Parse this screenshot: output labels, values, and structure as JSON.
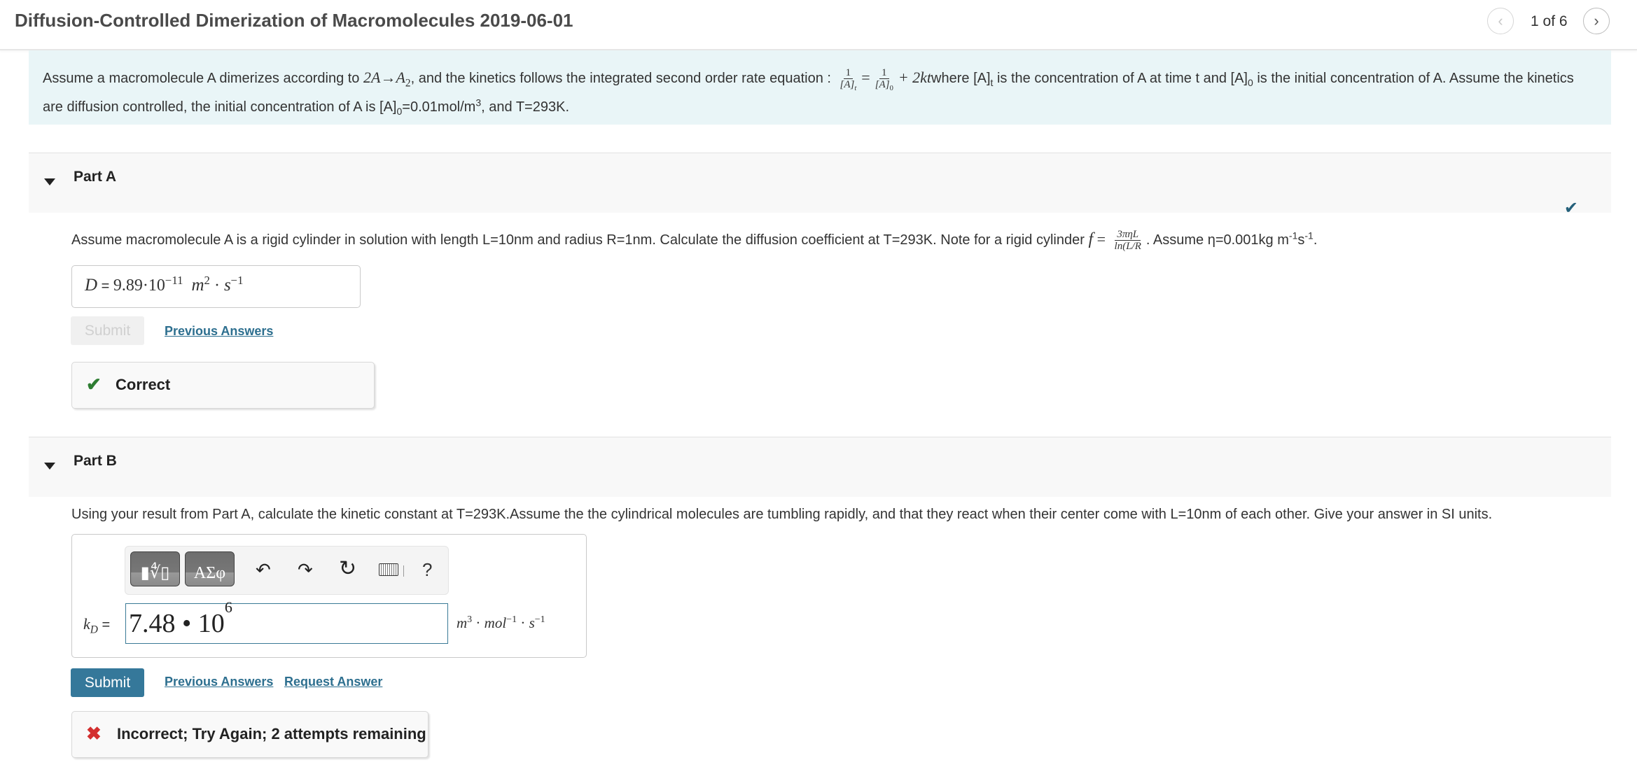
{
  "header": {
    "title": "Diffusion-Controlled Dimerization of Macromolecules 2019-06-01",
    "page_indicator": "1 of 6",
    "prev_icon": "chevron-left-icon",
    "next_icon": "chevron-right-icon"
  },
  "intro": {
    "t1": "Assume a macromolecule A dimerizes according to ",
    "reaction_lhs": "2A",
    "reaction_arrow": "→",
    "reaction_rhs": "A",
    "reaction_rhs_sub": "2",
    "t2": ", and the kinetics follows the integrated second order rate equation : ",
    "frac1_num": "1",
    "frac1_den": "[A]",
    "frac1_den_sub": "t",
    "equals": "=",
    "frac2_num": "1",
    "frac2_den": "[A]",
    "frac2_den_sub": "0",
    "plus_term": "+ 2kt",
    "t3": "where [A]",
    "t3_sub": "t",
    "t4": " is the concentration of A at time t and [A]",
    "t4_sub": "0",
    "t5": " is the initial concentration of A. Assume the kinetics are diffusion controlled, the initial concentration of A is [A]",
    "t5_sub": "0",
    "t6": "=0.01mol/m",
    "t6_sup": "3",
    "t7": ", and T=293K."
  },
  "part_a": {
    "title": "Part A",
    "status_icon": "checkmark-icon",
    "q1": "Assume macromolecule A is a rigid cylinder in solution with length L=10nm and radius R=1nm. Calculate the diffusion coefficient at T=293K. Note for a rigid cylinder ",
    "f_sym": "f",
    "f_eq": " = ",
    "f_num": "3πηL",
    "f_den": "ln(L/R",
    "q2": ". Assume η=0.001kg m",
    "q2_sup": "-1",
    "q3": "s",
    "q3_sup": "-1",
    "q4": ".",
    "answer_label": "D",
    "answer_eq": " = ",
    "answer_value": "9.89·10",
    "answer_exp": "−11",
    "answer_units_m": "m",
    "answer_units_m_sup": "2",
    "answer_units_dot": " · ",
    "answer_units_s": "s",
    "answer_units_s_sup": "−1",
    "submit_label": "Submit",
    "previous_answers_label": "Previous Answers",
    "feedback_text": "Correct",
    "feedback_icon": "checkmark-icon"
  },
  "part_b": {
    "title": "Part B",
    "question": "Using your result from Part A, calculate the kinetic constant at T=293K.Assume the the cylindrical molecules are tumbling rapidly, and that they react when their center come with L=10nm of each other. Give your answer in SI units.",
    "toolbar": {
      "templates_label": "▮∜▯",
      "symbols_label": "ΑΣφ",
      "undo_icon": "undo-icon",
      "redo_icon": "redo-icon",
      "reset_icon": "reset-icon",
      "keyboard_icon": "keyboard-icon",
      "help_label": "?"
    },
    "answer_label_k": "k",
    "answer_label_sub": "D",
    "answer_label_eq": " =",
    "answer_value": "7.48 • 10",
    "answer_exp": "6",
    "units_m": "m",
    "units_m_sup": "3",
    "units_dot1": " · ",
    "units_mol": "mol",
    "units_mol_sup": "−1",
    "units_dot2": " · ",
    "units_s": "s",
    "units_s_sup": "−1",
    "submit_label": "Submit",
    "previous_answers_label": "Previous Answers",
    "request_answer_label": "Request Answer",
    "feedback_text": "Incorrect; Try Again; 2 attempts remaining",
    "feedback_icon": "x-icon"
  },
  "colors": {
    "accent": "#35789a",
    "link": "#2d6f8f",
    "correct": "#2e7d32",
    "incorrect": "#d32f2f",
    "intro_bg": "#e9f5f7"
  }
}
